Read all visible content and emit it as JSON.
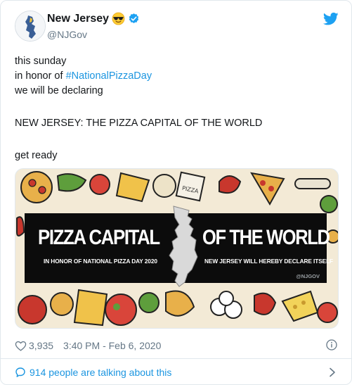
{
  "account": {
    "display_name": "New Jersey",
    "handle": "@NJGov",
    "emoji": "sunglasses-face",
    "verified": true
  },
  "tweet": {
    "lines": [
      "this sunday",
      "in honor of ",
      "we will be declaring",
      "NEW JERSEY: THE PIZZA CAPITAL OF THE WORLD",
      "get ready"
    ],
    "hashtag": "#NationalPizzaDay"
  },
  "media": {
    "title_left": "PIZZA CAPITAL",
    "title_right": "OF THE WORLD",
    "subtitle_left": "IN HONOR OF NATIONAL PIZZA DAY 2020",
    "subtitle_right": "NEW JERSEY WILL HEREBY DECLARE ITSELF",
    "watermark": "@NJGOV",
    "box_label": "PIZZA"
  },
  "meta": {
    "likes": "3,935",
    "timestamp": "3:40 PM - Feb 6, 2020"
  },
  "footer": {
    "talking": "914 people are talking about this"
  },
  "colors": {
    "link": "#1b95e0",
    "muted": "#657786",
    "banner": "#0c0c0c"
  }
}
